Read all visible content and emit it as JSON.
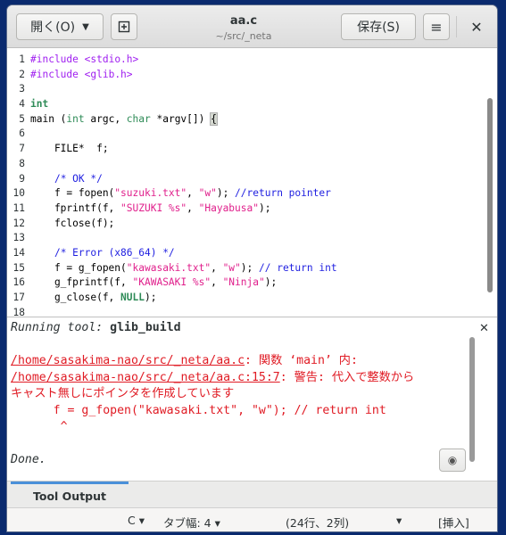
{
  "header": {
    "open_label": "開く(O)",
    "save_label": "保存(S)",
    "title": "aa.c",
    "subtitle": "~/src/_neta"
  },
  "code": {
    "line_numbers": [
      "1",
      "2",
      "3",
      "4",
      "5",
      "6",
      "7",
      "8",
      "9",
      "10",
      "11",
      "12",
      "13",
      "14",
      "15",
      "16",
      "17",
      "18"
    ]
  },
  "tool_output": {
    "running": "Running tool:",
    "tool_name": "glib_build",
    "path1": "/home/sasakima-nao/src/_neta/aa.c",
    "msg1": ": 関数 ‘main’ 内:",
    "path2": "/home/sasakima-nao/src/_neta/aa.c:15:7",
    "msg2": ": 警告: 代入で整数から",
    "msg3": "キャスト無しにポインタを作成しています",
    "code_line": "      f = g_fopen(\"kawasaki.txt\", \"w\"); // return int",
    "caret": "       ^",
    "done": "Done."
  },
  "bottom_tab": {
    "label": "Tool Output"
  },
  "statusbar": {
    "language": "C",
    "tab_width": "タブ幅: 4",
    "position": "(24行、2列)",
    "mode": "[挿入]"
  }
}
